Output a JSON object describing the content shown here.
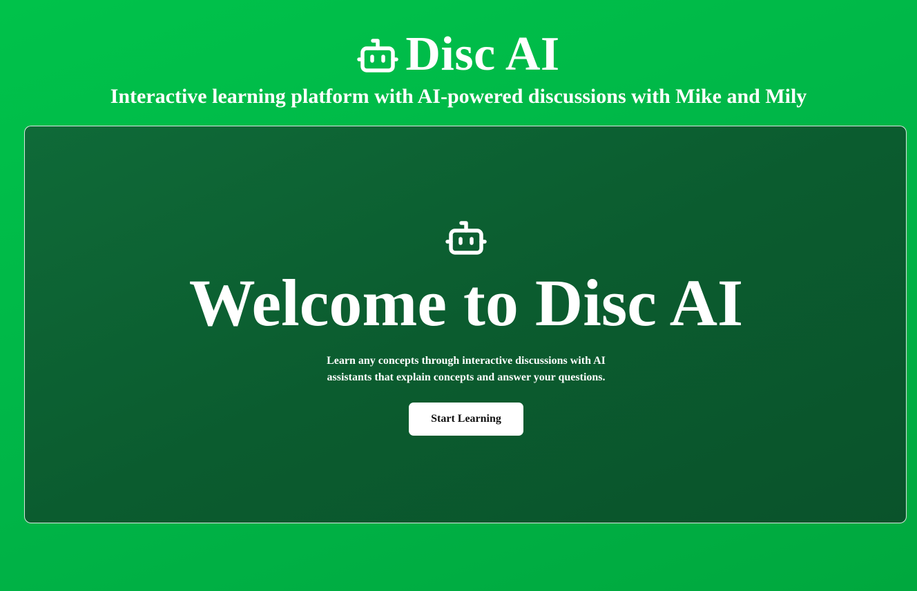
{
  "header": {
    "logo_icon": "robot-icon",
    "title": "Disc AI",
    "tagline": "Interactive learning platform with AI-powered discussions with Mike and Mily"
  },
  "hero": {
    "icon": "robot-icon",
    "title": "Welcome to Disc AI",
    "description": "Learn any concepts through interactive discussions with AI assistants that explain concepts and answer your questions.",
    "cta_label": "Start Learning"
  },
  "colors": {
    "page_background": "#00bb48",
    "card_background": "#0b5c2f",
    "button_background": "#ffffff",
    "button_text": "#111111",
    "text": "#ffffff"
  }
}
